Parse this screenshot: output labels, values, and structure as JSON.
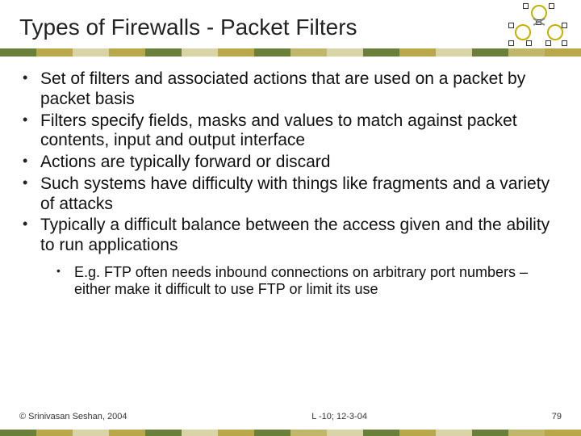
{
  "title": "Types of Firewalls - Packet Filters",
  "bullets": [
    "Set of filters and associated actions that are used on a packet by packet basis",
    "Filters specify fields, masks and values to match against packet contents, input and output interface",
    "Actions are typically forward or discard",
    "Such systems have difficulty with things like fragments and a variety of attacks",
    "Typically a difficult balance between the access given and the ability to run applications"
  ],
  "sub_bullets": [
    "E.g. FTP often needs inbound connections on arbitrary port numbers – either make it difficult to use FTP or limit its use"
  ],
  "footer": {
    "left": "© Srinivasan Seshan, 2004",
    "center": "L -10; 12-3-04",
    "right": "79"
  },
  "strip_colors": [
    "#6a7f3a",
    "#b8a84a",
    "#d9d4a8",
    "#b8a84a",
    "#6a7f3a",
    "#d9d4a8",
    "#b8a84a",
    "#6a7f3a",
    "#c1b76a",
    "#d9d4a8",
    "#6a7f3a",
    "#b8a84a",
    "#d9d4a8",
    "#6a7f3a",
    "#c1b76a",
    "#b8a84a"
  ]
}
